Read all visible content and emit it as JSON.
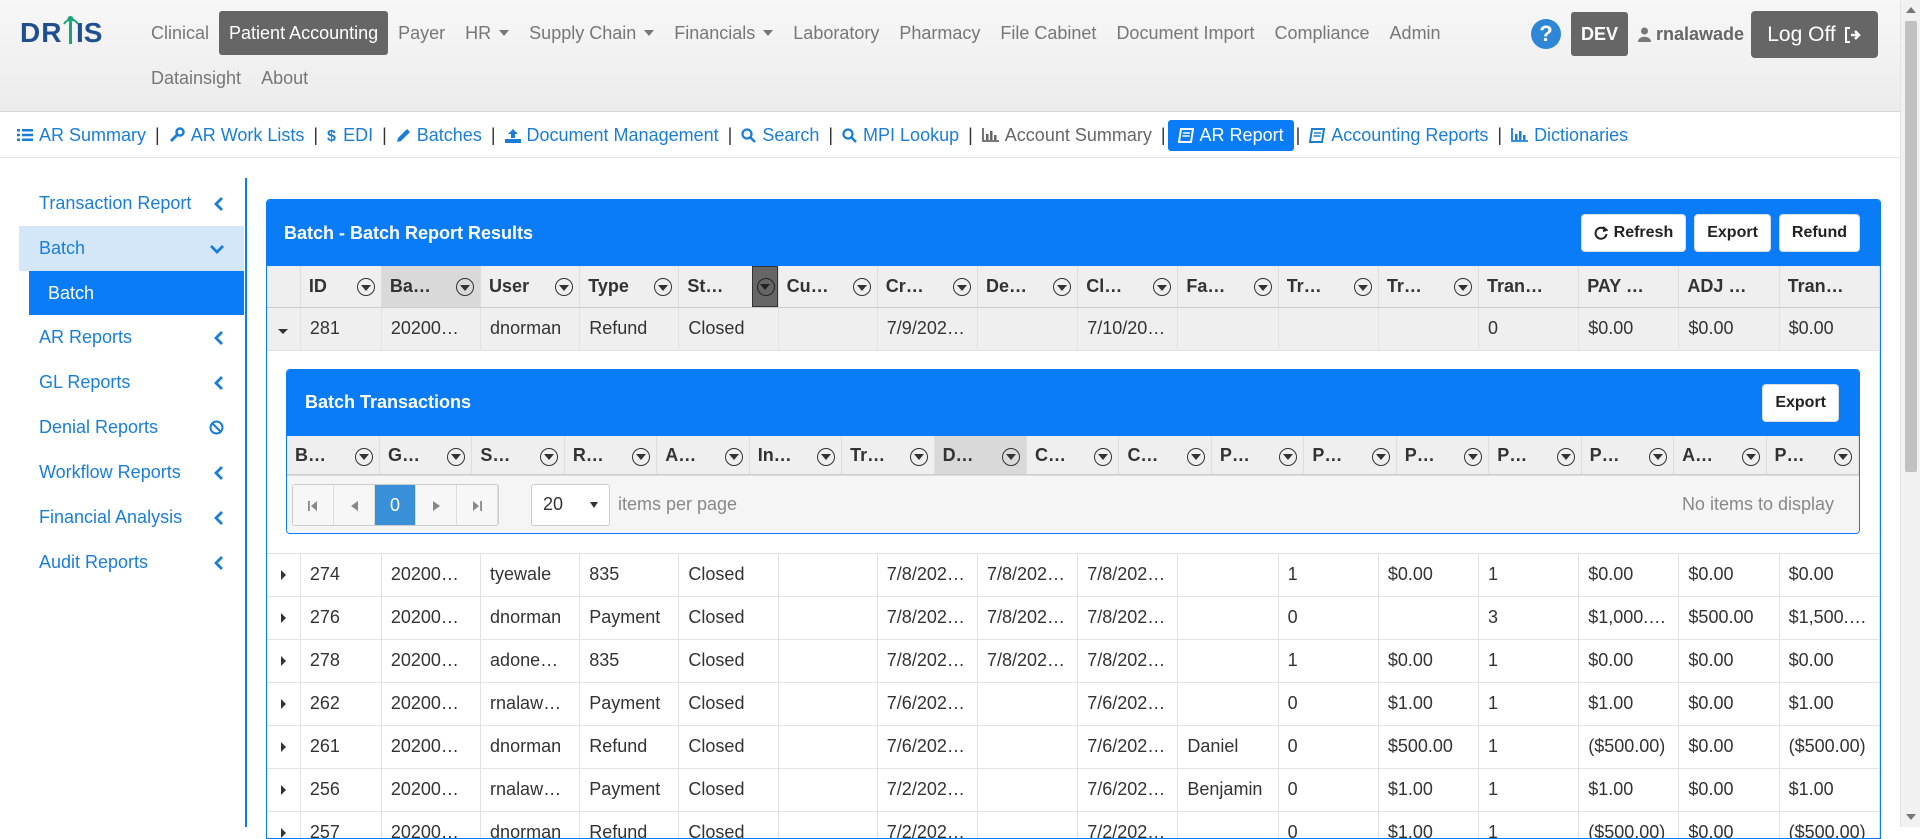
{
  "app": {
    "logo_text": "DRIS",
    "menu_row1": [
      {
        "label": "Clinical",
        "dropdown": false,
        "active": false
      },
      {
        "label": "Patient Accounting",
        "dropdown": false,
        "active": true
      },
      {
        "label": "Payer",
        "dropdown": false,
        "active": false
      },
      {
        "label": "HR",
        "dropdown": true,
        "active": false
      },
      {
        "label": "Supply Chain",
        "dropdown": true,
        "active": false
      },
      {
        "label": "Financials",
        "dropdown": true,
        "active": false
      },
      {
        "label": "Laboratory",
        "dropdown": false,
        "active": false
      },
      {
        "label": "Pharmacy",
        "dropdown": false,
        "active": false
      },
      {
        "label": "File Cabinet",
        "dropdown": false,
        "active": false
      },
      {
        "label": "Document Import",
        "dropdown": false,
        "active": false
      },
      {
        "label": "Compliance",
        "dropdown": false,
        "active": false
      },
      {
        "label": "Admin",
        "dropdown": false,
        "active": false
      }
    ],
    "menu_row2": [
      {
        "label": "Datainsight"
      },
      {
        "label": "About"
      }
    ],
    "help": "?",
    "env": "DEV",
    "username": "rnalawade",
    "logoff": "Log Off"
  },
  "modules": [
    {
      "label": "AR Summary",
      "icon": "list-icon",
      "style": "link"
    },
    {
      "label": "AR Work Lists",
      "icon": "wrench-icon",
      "style": "link"
    },
    {
      "label": "EDI",
      "icon": "dollar-icon",
      "style": "link"
    },
    {
      "label": "Batches",
      "icon": "pencil-icon",
      "style": "link"
    },
    {
      "label": "Document Management",
      "icon": "upload-icon",
      "style": "link"
    },
    {
      "label": "Search",
      "icon": "search-icon",
      "style": "link"
    },
    {
      "label": "MPI Lookup",
      "icon": "search-icon",
      "style": "link"
    },
    {
      "label": "Account Summary",
      "icon": "bar-chart-icon",
      "style": "gray"
    },
    {
      "label": "AR Report",
      "icon": "book-icon",
      "style": "active"
    },
    {
      "label": "Accounting Reports",
      "icon": "book-icon",
      "style": "link"
    },
    {
      "label": "Dictionaries",
      "icon": "bar-chart-icon",
      "style": "link"
    }
  ],
  "sidebar": {
    "items": [
      {
        "label": "Transaction Report",
        "icon": "chevron-left-icon"
      },
      {
        "label": "Batch",
        "icon": "chevron-down-icon",
        "open": true,
        "sub": "Batch"
      },
      {
        "label": "AR Reports",
        "icon": "chevron-left-icon"
      },
      {
        "label": "GL Reports",
        "icon": "chevron-left-icon"
      },
      {
        "label": "Denial Reports",
        "icon": "ban-icon"
      },
      {
        "label": "Workflow Reports",
        "icon": "chevron-left-icon"
      },
      {
        "label": "Financial Analysis",
        "icon": "chevron-left-icon"
      },
      {
        "label": "Audit Reports",
        "icon": "chevron-left-icon"
      }
    ]
  },
  "panel": {
    "title": "Batch - Batch Report Results",
    "buttons": {
      "refresh": "Refresh",
      "export": "Export",
      "refund": "Refund"
    },
    "columns": [
      "ID",
      "Ba…",
      "User",
      "Type",
      "St…",
      "Cu…",
      "Cr…",
      "De…",
      "Cl…",
      "Fa…",
      "Tr…",
      "Tr…",
      "Trans #",
      "PAY To…",
      "ADJ T…",
      "Trans …"
    ],
    "sorted_column": 1,
    "dark_filter_column": 4,
    "expanded_row": [
      "281",
      "20200…",
      "dnorman",
      "Refund",
      "Closed",
      "",
      "7/9/202…",
      "",
      "7/10/20…",
      "",
      "",
      "",
      "0",
      "$0.00",
      "$0.00",
      "$0.00"
    ],
    "rows": [
      [
        "274",
        "20200…",
        "tyewale",
        "835",
        "Closed",
        "",
        "7/8/202…",
        "7/8/202…",
        "7/8/202…",
        "",
        "1",
        "$0.00",
        "1",
        "$0.00",
        "$0.00",
        "$0.00"
      ],
      [
        "276",
        "20200…",
        "dnorman",
        "Payment",
        "Closed",
        "",
        "7/8/202…",
        "7/8/202…",
        "7/8/202…",
        "",
        "0",
        "",
        "3",
        "$1,000.…",
        "$500.00",
        "$1,500.…"
      ],
      [
        "278",
        "20200…",
        "adone…",
        "835",
        "Closed",
        "",
        "7/8/202…",
        "7/8/202…",
        "7/8/202…",
        "",
        "1",
        "$0.00",
        "1",
        "$0.00",
        "$0.00",
        "$0.00"
      ],
      [
        "262",
        "20200…",
        "rnalaw…",
        "Payment",
        "Closed",
        "",
        "7/6/202…",
        "",
        "7/6/202…",
        "",
        "0",
        "$1.00",
        "1",
        "$1.00",
        "$0.00",
        "$1.00"
      ],
      [
        "261",
        "20200…",
        "dnorman",
        "Refund",
        "Closed",
        "",
        "7/6/202…",
        "",
        "7/6/202…",
        "Daniel",
        "0",
        "$500.00",
        "1",
        "($500.00)",
        "$0.00",
        "($500.00)"
      ],
      [
        "256",
        "20200…",
        "rnalaw…",
        "Payment",
        "Closed",
        "",
        "7/2/202…",
        "",
        "7/6/202…",
        "Benjamin",
        "0",
        "$1.00",
        "1",
        "$1.00",
        "$0.00",
        "$1.00"
      ],
      [
        "257",
        "20200…",
        "dnorman",
        "Refund",
        "Closed",
        "",
        "7/2/202…",
        "",
        "7/2/202…",
        "",
        "0",
        "$1.00",
        "1",
        "($500.00)",
        "$0.00",
        "($500.00)"
      ]
    ]
  },
  "subpanel": {
    "title": "Batch Transactions",
    "export": "Export",
    "columns": [
      "B…",
      "G…",
      "S…",
      "R…",
      "A…",
      "In…",
      "Tr…",
      "D…",
      "C…",
      "C…",
      "P…",
      "P…",
      "P…",
      "P…",
      "P…",
      "A…",
      "P…"
    ],
    "sorted_column": 7,
    "pager": {
      "current_page": "0",
      "page_size": "20",
      "items_per_page": "items per page",
      "empty": "No items to display"
    }
  }
}
